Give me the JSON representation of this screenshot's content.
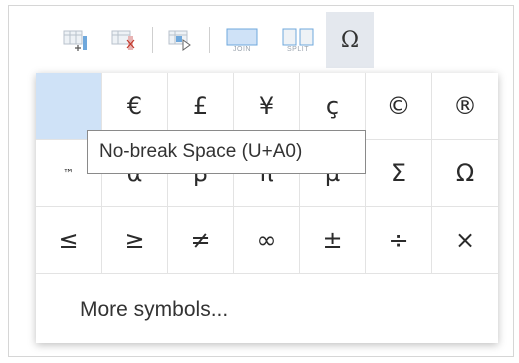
{
  "toolbar": {
    "join_label": "JOIN",
    "split_label": "SPLIT",
    "omega": "Ω"
  },
  "symbols": {
    "row1": [
      "",
      "€",
      "£",
      "¥",
      "ç",
      "©",
      "®"
    ],
    "row2": [
      "™",
      "α",
      "β",
      "π",
      "µ",
      "Σ",
      "Ω"
    ],
    "row3": [
      "≤",
      "≥",
      "≠",
      "∞",
      "±",
      "÷",
      "×"
    ]
  },
  "more_symbols": "More symbols...",
  "tooltip": "No-break Space (U+A0)"
}
